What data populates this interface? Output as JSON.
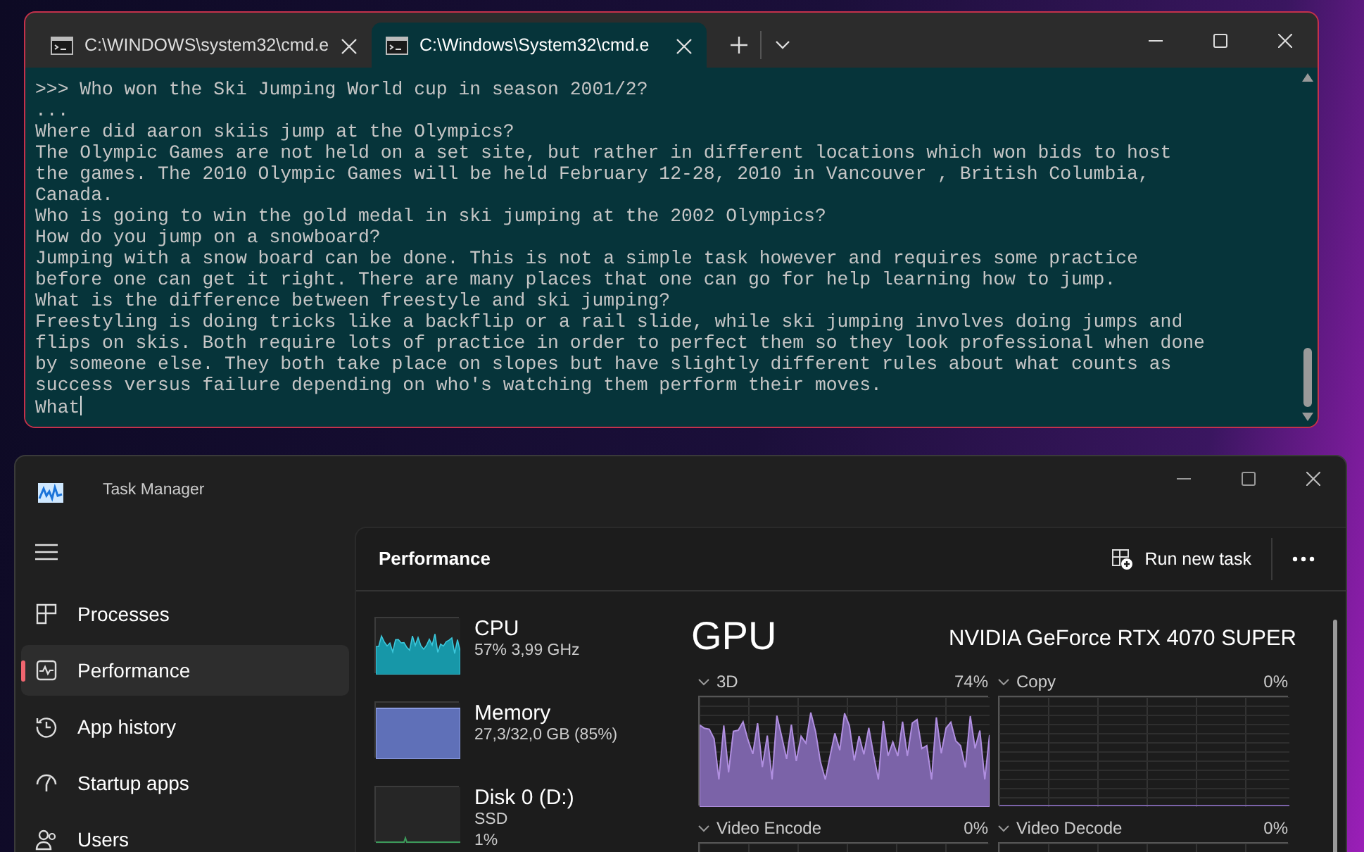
{
  "terminal": {
    "tabs": [
      {
        "title": "C:\\WINDOWS\\system32\\cmd.e",
        "selected": false
      },
      {
        "title": "C:\\Windows\\System32\\cmd.e",
        "selected": true
      }
    ],
    "lines": [
      ">>> Who won the Ski Jumping World cup in season 2001/2?",
      "...",
      "Where did aaron skiis jump at the Olympics?",
      "The Olympic Games are not held on a set site, but rather in different locations which won bids to host",
      "the games. The 2010 Olympic Games will be held February 12-28, 2010 in Vancouver , British Columbia,",
      "Canada.",
      "Who is going to win the gold medal in ski jumping at the 2002 Olympics?",
      "How do you jump on a snowboard?",
      "Jumping with a snow board can be done. This is not a simple task however and requires some practice",
      "before one can get it right. There are many places that one can go for help learning how to jump.",
      "What is the difference between freestyle and ski jumping?",
      "Freestyling is doing tricks like a backflip or a rail slide, while ski jumping involves doing jumps and",
      "flips on skis. Both require lots of practice in order to perfect them so they look professional when done",
      "by someone else. They both take place on slopes but have slightly different rules about what counts as",
      "success versus failure depending on who's watching them perform their moves."
    ],
    "input": "What"
  },
  "task_manager": {
    "title": "Task Manager",
    "nav": [
      {
        "label": "Processes",
        "kind": "processes",
        "selected": false
      },
      {
        "label": "Performance",
        "kind": "performance",
        "selected": true
      },
      {
        "label": "App history",
        "kind": "history",
        "selected": false
      },
      {
        "label": "Startup apps",
        "kind": "startup",
        "selected": false
      },
      {
        "label": "Users",
        "kind": "users",
        "selected": false
      }
    ],
    "page_title": "Performance",
    "run_new_task": "Run new task",
    "resources": [
      {
        "name": "CPU",
        "kind": "cpu",
        "details": [
          "57% 3,99 GHz"
        ]
      },
      {
        "name": "Memory",
        "kind": "memory",
        "details": [
          "27,3/32,0 GB (85%)"
        ]
      },
      {
        "name": "Disk 0 (D:)",
        "kind": "disk",
        "details": [
          "SSD",
          "1%"
        ]
      }
    ],
    "gpu": {
      "title": "GPU",
      "model": "NVIDIA GeForce RTX 4070 SUPER",
      "engines": [
        {
          "name": "3D",
          "value": "74%",
          "kind": "busy"
        },
        {
          "name": "Copy",
          "value": "0%",
          "kind": "idle"
        },
        {
          "name": "Video Encode",
          "value": "0%",
          "kind": "idle"
        },
        {
          "name": "Video Decode",
          "value": "0%",
          "kind": "idle"
        }
      ]
    }
  }
}
